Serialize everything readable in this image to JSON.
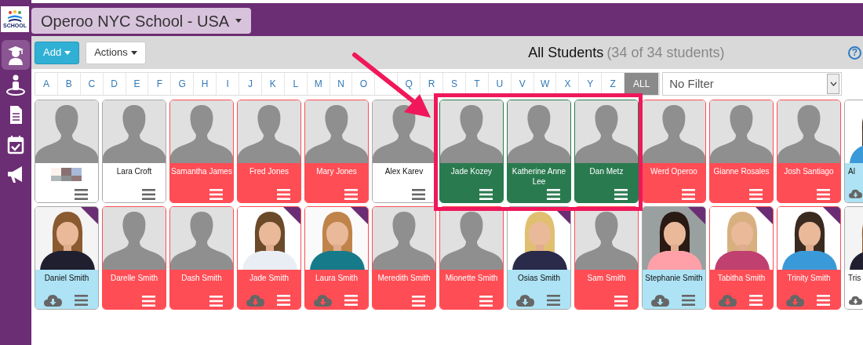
{
  "logo": {
    "text": "SCHOOL"
  },
  "sidebar": {
    "items": [
      {
        "kind": "graduate",
        "selected": true
      },
      {
        "kind": "person",
        "selected": false
      },
      {
        "kind": "document",
        "selected": false
      },
      {
        "kind": "calendar",
        "selected": false
      },
      {
        "kind": "megaphone",
        "selected": false
      }
    ]
  },
  "school_selector": {
    "label": "Operoo NYC School - USA"
  },
  "toolbar": {
    "buttons": [
      {
        "label": "Add",
        "kind": "primary"
      },
      {
        "label": "Actions",
        "kind": "default"
      }
    ],
    "title": "All Students",
    "count": "(34 of 34 students)",
    "help": "?"
  },
  "letters": [
    {
      "label": "A",
      "selected": false
    },
    {
      "label": "B",
      "selected": false
    },
    {
      "label": "C",
      "selected": false
    },
    {
      "label": "D",
      "selected": false
    },
    {
      "label": "E",
      "selected": false
    },
    {
      "label": "F",
      "selected": false
    },
    {
      "label": "G",
      "selected": false
    },
    {
      "label": "H",
      "selected": false
    },
    {
      "label": "I",
      "selected": false
    },
    {
      "label": "J",
      "selected": false
    },
    {
      "label": "K",
      "selected": false
    },
    {
      "label": "L",
      "selected": false
    },
    {
      "label": "M",
      "selected": false
    },
    {
      "label": "N",
      "selected": false
    },
    {
      "label": "O",
      "selected": false
    },
    {
      "selected": false
    },
    {
      "label": "Q",
      "selected": false
    },
    {
      "label": "R",
      "selected": false
    },
    {
      "label": "S",
      "selected": false
    },
    {
      "label": "T",
      "selected": false
    },
    {
      "label": "U",
      "selected": false
    },
    {
      "label": "V",
      "selected": false
    },
    {
      "label": "W",
      "selected": false
    },
    {
      "label": "X",
      "selected": false
    },
    {
      "label": "Y",
      "selected": false
    },
    {
      "label": "Z",
      "selected": false
    },
    {
      "label": "ALL",
      "selected": true
    }
  ],
  "filter": {
    "value": "No Filter"
  },
  "rows": [
    {
      "cards": [
        {
          "name_hidden": true,
          "color": "#ffffff",
          "photo": false,
          "flag": false,
          "download": false
        },
        {
          "name": "Lara Croft",
          "color": "#ffffff",
          "photo": false,
          "flag": false,
          "download": false
        },
        {
          "name": "Samantha James",
          "color": "#ff4d55",
          "photo": false,
          "flag": false,
          "download": false
        },
        {
          "name": "Fred Jones",
          "color": "#ff4d55",
          "photo": false,
          "flag": false,
          "download": false
        },
        {
          "name": "Mary Jones",
          "color": "#ff4d55",
          "photo": false,
          "flag": false,
          "download": false
        },
        {
          "name": "Alex Karev",
          "color": "#ffffff",
          "photo": false,
          "flag": false,
          "download": false
        },
        {
          "name": "Jade Kozey",
          "color": "#2a7a50",
          "photo": false,
          "flag": false,
          "download": false
        },
        {
          "name": "Katherine Anne Lee",
          "color": "#2a7a50",
          "photo": false,
          "flag": false,
          "download": false
        },
        {
          "name": "Dan Metz",
          "color": "#2a7a50",
          "photo": false,
          "flag": false,
          "download": false
        },
        {
          "name": "Werd Operoo",
          "color": "#ff4d55",
          "photo": false,
          "flag": false,
          "download": false
        },
        {
          "name": "Gianne Rosales",
          "color": "#ff4d55",
          "photo": false,
          "flag": false,
          "download": false
        },
        {
          "name": "Josh Santiago",
          "color": "#ff4d55",
          "photo": false,
          "flag": false,
          "download": false
        },
        {
          "name": "Al",
          "color": "#ade3f4",
          "photo": true,
          "flag": false,
          "download": true,
          "partial": true
        }
      ]
    },
    {
      "cards": [
        {
          "name": "Daniel Smith",
          "color": "#ade3f4",
          "photo": true,
          "flag": true,
          "download": true
        },
        {
          "name": "Darelle Smith",
          "color": "#ff4d55",
          "photo": false,
          "flag": false,
          "download": false
        },
        {
          "name": "Dash Smith",
          "color": "#ff4d55",
          "photo": false,
          "flag": false,
          "download": false
        },
        {
          "name": "Jade Smith",
          "color": "#ff4d55",
          "photo": true,
          "flag": true,
          "download": true
        },
        {
          "name": "Laura Smith",
          "color": "#ff4d55",
          "photo": true,
          "flag": true,
          "download": true
        },
        {
          "name": "Meredith Smith",
          "color": "#ff4d55",
          "photo": false,
          "flag": false,
          "download": false
        },
        {
          "name": "Mionette Smith",
          "color": "#ff4d55",
          "photo": false,
          "flag": false,
          "download": false
        },
        {
          "name": "Osias Smith",
          "color": "#ade3f4",
          "photo": true,
          "flag": true,
          "download": true
        },
        {
          "name": "Sam Smith",
          "color": "#ff4d55",
          "photo": false,
          "flag": false,
          "download": false
        },
        {
          "name": "Stephanie Smith",
          "color": "#ade3f4",
          "photo": true,
          "flag": true,
          "download": true
        },
        {
          "name": "Tabitha Smith",
          "color": "#ff4d55",
          "photo": true,
          "flag": true,
          "download": true
        },
        {
          "name": "Trinity Smith",
          "color": "#ff4d55",
          "photo": true,
          "flag": true,
          "download": true
        },
        {
          "name": "Tris",
          "color": "#ffffff",
          "photo": true,
          "flag": false,
          "download": true,
          "partial": true
        }
      ]
    }
  ]
}
